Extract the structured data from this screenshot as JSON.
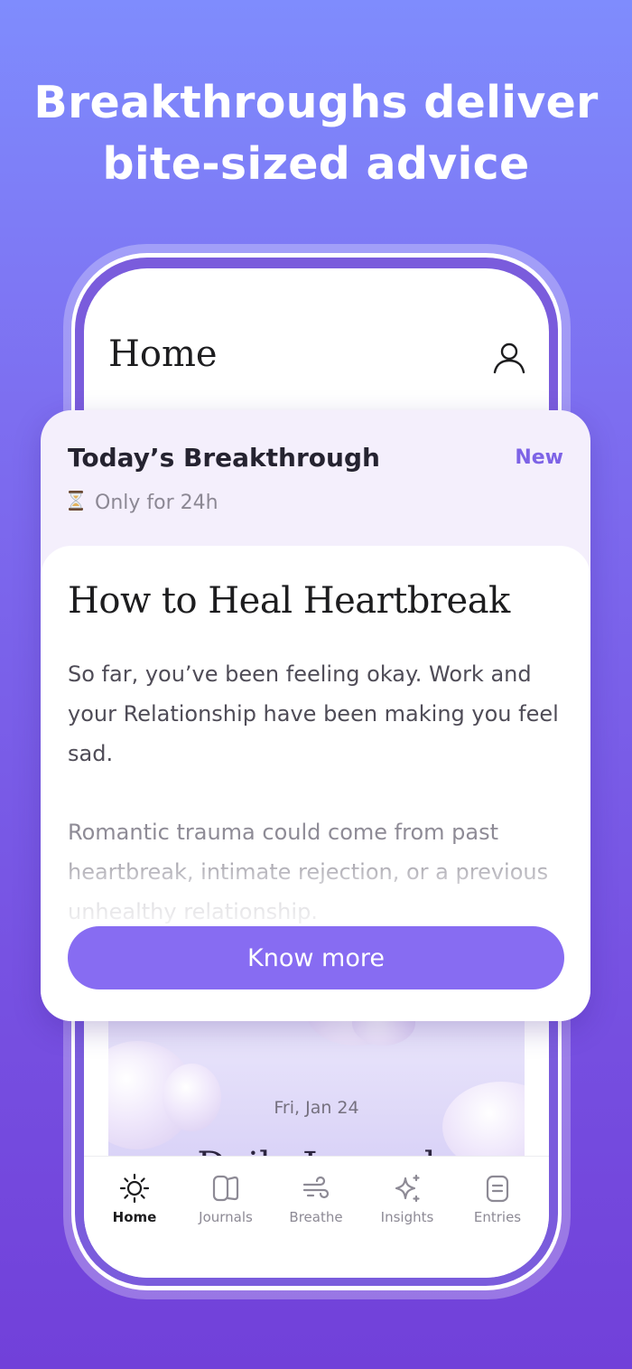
{
  "headline": {
    "line1": "Breakthroughs deliver",
    "line2": "bite-sized advice"
  },
  "screen": {
    "title": "Home",
    "journal": {
      "date": "Fri, Jan 24",
      "title_peek": "Daily Journal"
    },
    "tabs": [
      {
        "label": "Home",
        "icon": "sun-icon",
        "active": true
      },
      {
        "label": "Journals",
        "icon": "journals-icon",
        "active": false
      },
      {
        "label": "Breathe",
        "icon": "wind-icon",
        "active": false
      },
      {
        "label": "Insights",
        "icon": "sparkle-icon",
        "active": false
      },
      {
        "label": "Entries",
        "icon": "entries-icon",
        "active": false
      }
    ]
  },
  "breakthrough": {
    "heading": "Today’s Breakthrough",
    "badge": "New",
    "timer": "Only for 24h",
    "timer_icon": "hourglass-icon",
    "title": "How to Heal Heartbreak",
    "paragraph1": "So far, you’ve been feeling okay. Work and your Relationship have been making you feel sad.",
    "paragraph2": "Romantic trauma could come from past heartbreak, intimate rejection, or a previous unhealthy relationship.",
    "cta": "Know more"
  },
  "colors": {
    "accent": "#876cf2",
    "badge": "#7d63e6",
    "background_top": "#7f8cfd",
    "background_bottom": "#7140d9"
  }
}
